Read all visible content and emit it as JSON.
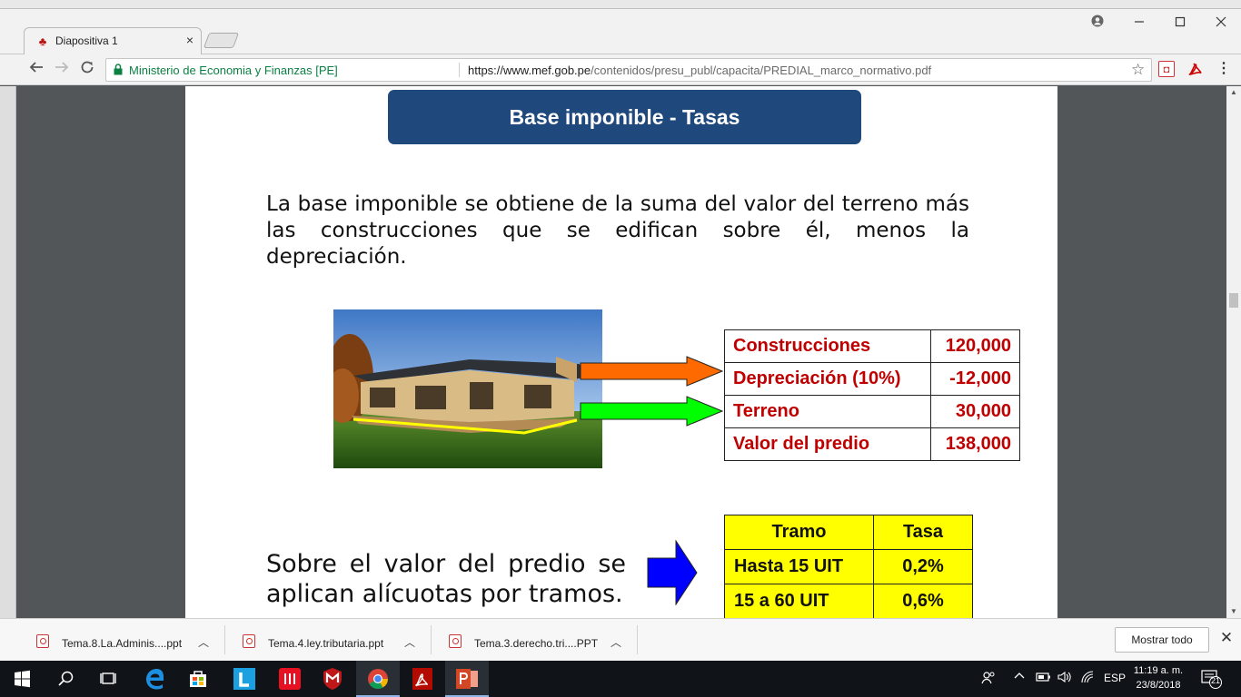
{
  "browser": {
    "tab_title": "Diapositiva 1",
    "tab_close": "×",
    "site_identity": "Ministerio de Economia y Finanzas [PE]",
    "url_host": "https://www.mef.gob.pe",
    "url_path": "/contenidos/presu_publ/capacita/PREDIAL_marco_normativo.pdf",
    "icons": [
      "back-icon",
      "forward-icon",
      "reload-icon",
      "lock-icon",
      "star-icon",
      "profile-icon",
      "minimize-icon",
      "maximize-icon",
      "close-icon"
    ]
  },
  "slide": {
    "title": "Base imponible - Tasas",
    "intro": "La base imponible se obtiene de la suma del valor del terreno más las construcciones que se edifican sobre él, menos la depreciación.",
    "value_table": [
      {
        "label": "Construcciones",
        "value": "120,000"
      },
      {
        "label": "Depreciación (10%)",
        "value": "-12,000"
      },
      {
        "label": "Terreno",
        "value": "30,000"
      },
      {
        "label": "Valor del predio",
        "value": "138,000"
      }
    ],
    "rates_text": "Sobre el valor del predio se aplican alícuotas por tramos.",
    "rate_table": {
      "headers": [
        "Tramo",
        "Tasa"
      ],
      "rows": [
        {
          "tramo": "Hasta 15 UIT",
          "tasa": "0,2%"
        },
        {
          "tramo": "15 a 60 UIT",
          "tasa": "0,6%"
        }
      ]
    },
    "colors": {
      "title_bg": "#1f497d",
      "value_text": "#c00000",
      "rate_bg": "#ffff00",
      "arrow_orange": "#ff6a00",
      "arrow_green": "#00ff00",
      "arrow_blue": "#0000ff"
    }
  },
  "downloads": {
    "items": [
      {
        "name": "Tema.8.La.Adminis....ppt"
      },
      {
        "name": "Tema.4.ley.tributaria.ppt"
      },
      {
        "name": "Tema.3.derecho.tri....PPT"
      }
    ],
    "show_all": "Mostrar todo",
    "close": "✕"
  },
  "taskbar": {
    "language": "ESP",
    "time": "11:19 a. m.",
    "date": "23/8/2018",
    "notifications": "21"
  }
}
